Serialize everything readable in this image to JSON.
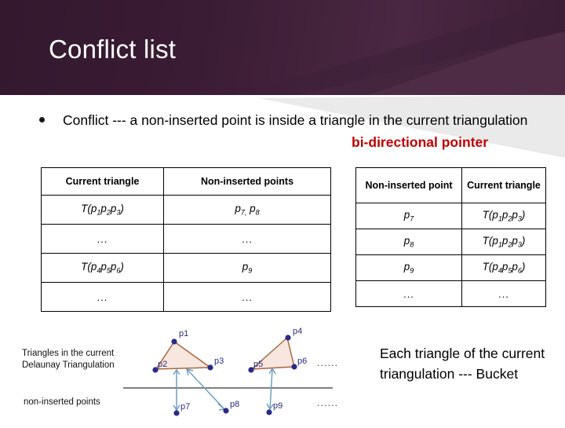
{
  "slide": {
    "title": "Conflict list",
    "banner_color_dark": "#33182e",
    "banner_color_light": "#4a2742"
  },
  "bullet": {
    "marker": "bullet-dot",
    "text": "Conflict --- a non-inserted point is inside a triangle in the current triangulation"
  },
  "pointer_label": {
    "text": "bi-directional pointer",
    "color": "#c00000"
  },
  "table_left": {
    "headers": [
      "Current triangle",
      "Non-inserted points"
    ],
    "rows": [
      [
        "T(p1p2p3)",
        "p7, p8"
      ],
      [
        "...",
        "..."
      ],
      [
        "T(p4p5p6)",
        "p9"
      ],
      [
        "...",
        "..."
      ]
    ]
  },
  "table_right": {
    "headers": [
      "Non-inserted point",
      "Current triangle"
    ],
    "rows": [
      [
        "p7",
        "T(p1p2p3)"
      ],
      [
        "p8",
        "T(p1p2p3)"
      ],
      [
        "p9",
        "T(p4p5p6)"
      ],
      [
        "...",
        "..."
      ]
    ]
  },
  "diagram": {
    "label_top": "Triangles in the current Delaunay Triangulation",
    "label_bottom": "non-inserted points",
    "ellipsis_upper": "......",
    "ellipsis_lower": "......",
    "point_labels": [
      "p1",
      "p2",
      "p3",
      "p4",
      "p5",
      "p6",
      "p7",
      "p8",
      "p9"
    ],
    "point_color": "#2a2a86",
    "triangle_fill": "#f7e7df",
    "triangle_stroke": "#a9683f",
    "arrow_color": "#6f9fc0",
    "axis_color": "#555555"
  },
  "bucket_note": {
    "text": "Each triangle of the current triangulation --- Bucket"
  }
}
